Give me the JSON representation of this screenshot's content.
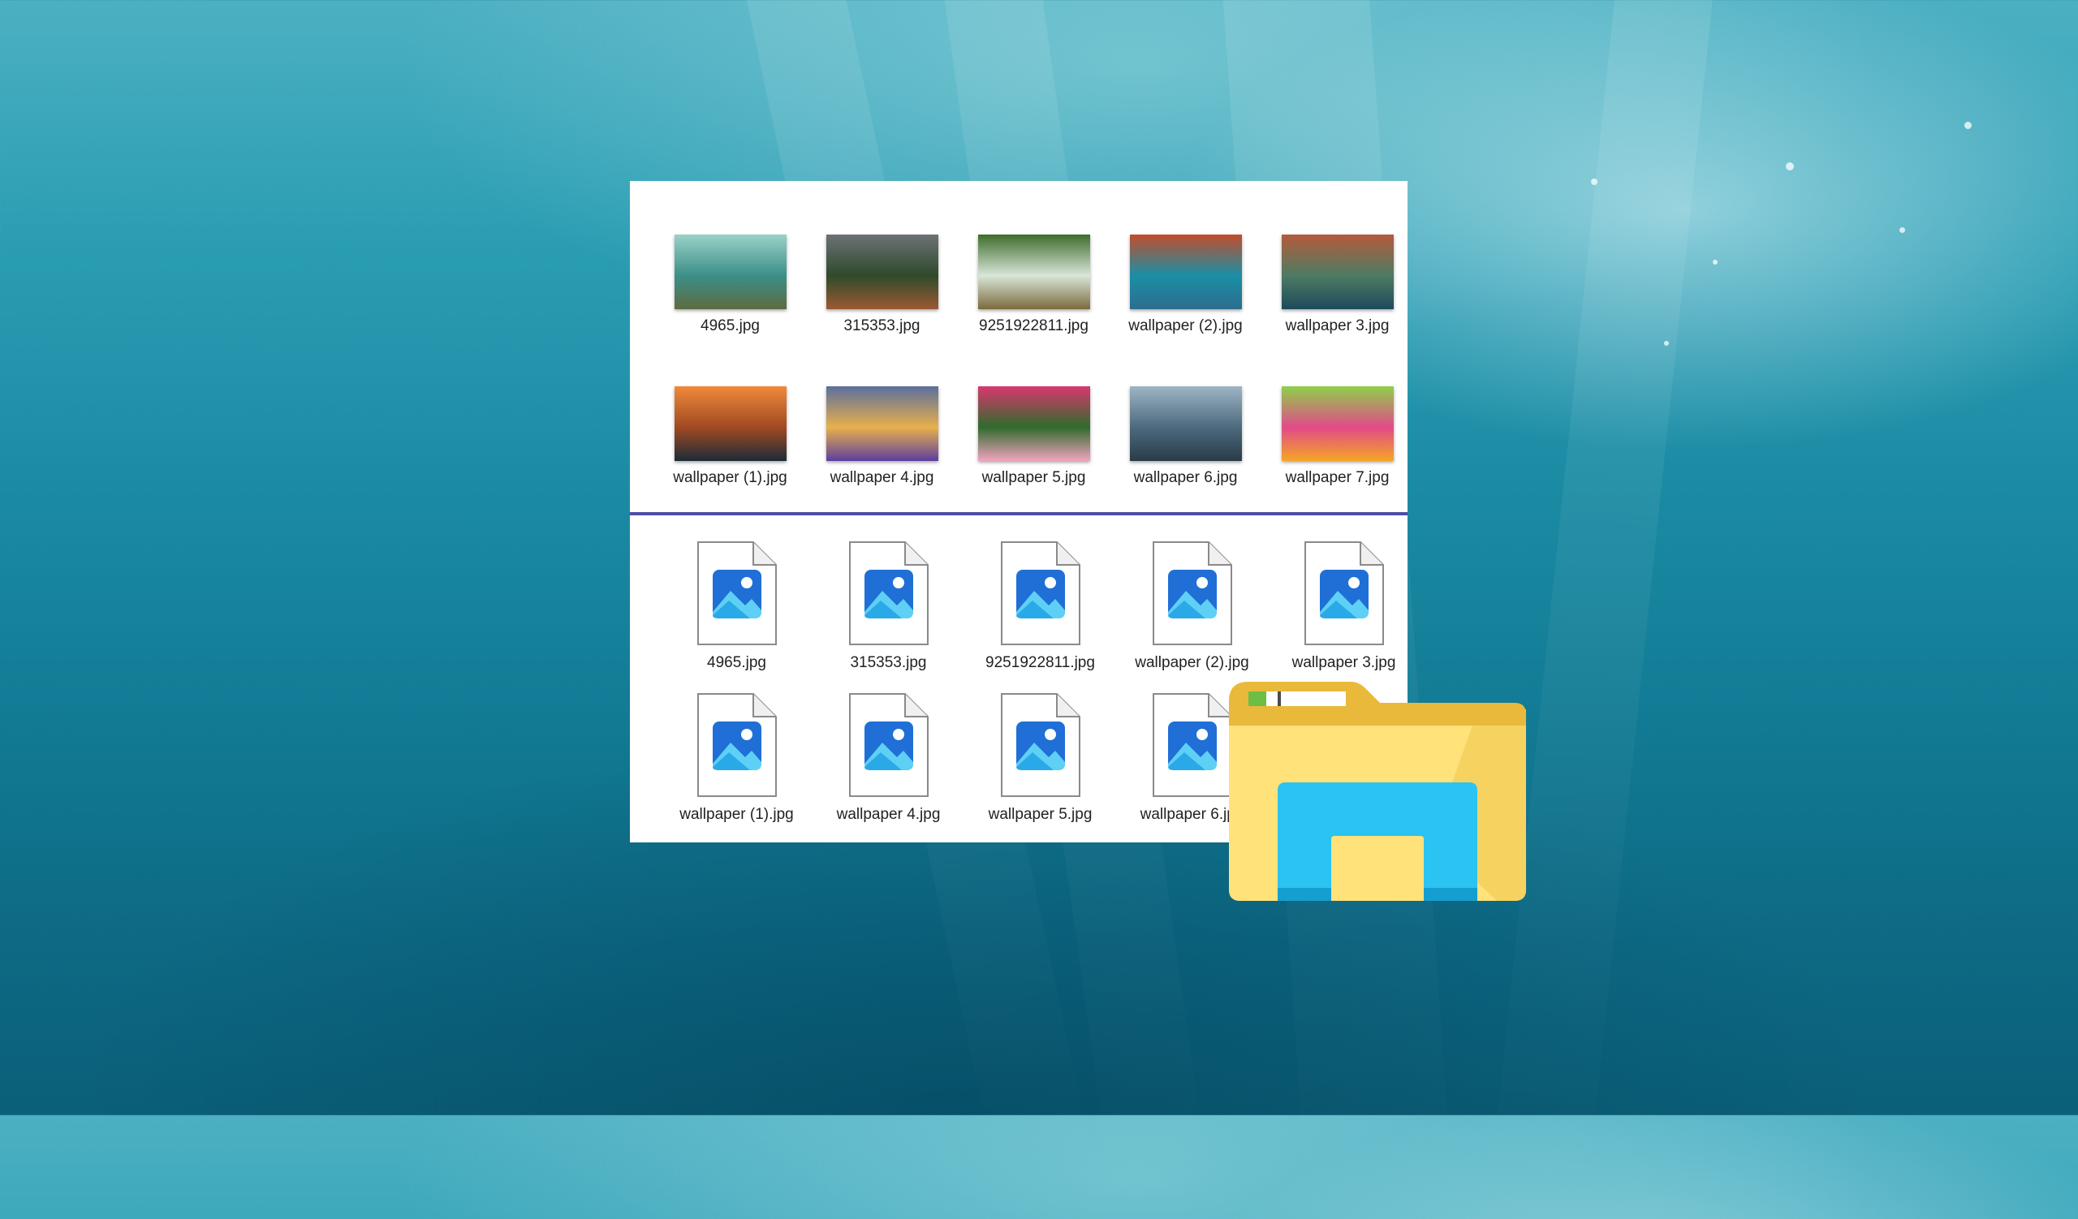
{
  "thumbnails": [
    {
      "label": "4965.jpg",
      "colors": [
        "#9ad2c9",
        "#3c8f88",
        "#5d6b3f"
      ]
    },
    {
      "label": "315353.jpg",
      "colors": [
        "#6d7276",
        "#2f4a2b",
        "#9b5a33"
      ]
    },
    {
      "label": "9251922811.jpg",
      "colors": [
        "#3f6c2c",
        "#d8e6d8",
        "#7b6a3c"
      ]
    },
    {
      "label": "wallpaper  (2).jpg",
      "colors": [
        "#c24d2c",
        "#1a8fa6",
        "#2d6d8e"
      ]
    },
    {
      "label": "wallpaper  3.jpg",
      "colors": [
        "#b45b3b",
        "#4d7b63",
        "#1d4a5c"
      ]
    },
    {
      "label": "wallpaper (1).jpg",
      "colors": [
        "#f08a3a",
        "#a04a22",
        "#1c2b38"
      ]
    },
    {
      "label": "wallpaper 4.jpg",
      "colors": [
        "#5b6f9d",
        "#e8b04c",
        "#5c3ea0"
      ]
    },
    {
      "label": "wallpaper 5.jpg",
      "colors": [
        "#d9376f",
        "#2f6b2c",
        "#f2a3c0"
      ]
    },
    {
      "label": "wallpaper 6.jpg",
      "colors": [
        "#9fb5c4",
        "#4c6a7e",
        "#2a3b48"
      ]
    },
    {
      "label": "wallpaper 7.jpg",
      "colors": [
        "#8fd04a",
        "#e24a8a",
        "#f5a623"
      ]
    }
  ],
  "files": [
    {
      "label": "4965.jpg"
    },
    {
      "label": "315353.jpg"
    },
    {
      "label": "9251922811.jpg"
    },
    {
      "label": "wallpaper  (2).jpg"
    },
    {
      "label": "wallpaper  3.jpg"
    },
    {
      "label": "wallpaper (1).jpg"
    },
    {
      "label": "wallpaper 4.jpg"
    },
    {
      "label": "wallpaper 5.jpg"
    },
    {
      "label": "wallpaper 6.jpg"
    }
  ],
  "icons": {
    "file": "image-file-icon",
    "logo": "file-explorer-folder-icon"
  },
  "colors": {
    "divider": "#4b4fa6",
    "folder_yellow": "#ffe27a",
    "folder_blue": "#2bc3f1"
  }
}
